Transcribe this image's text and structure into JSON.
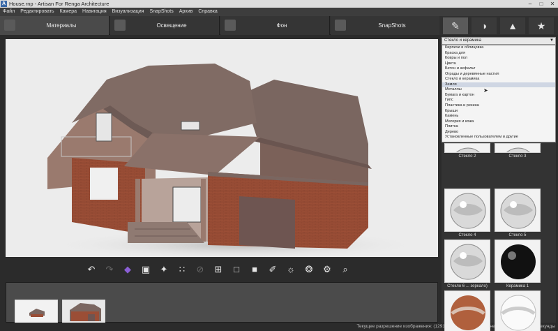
{
  "window": {
    "app_icon": "A",
    "title": "House.rnp - Artisan For Renga Architecture",
    "minimize": "–",
    "maximize": "□",
    "close": "✕"
  },
  "menu": [
    "Файл",
    "Редактировать",
    "Камера",
    "Навигация",
    "Визуализация",
    "SnapShots",
    "Архив",
    "Справка"
  ],
  "tabs": [
    {
      "label": "Материалы",
      "icon": "materials-icon",
      "active": true
    },
    {
      "label": "Освещение",
      "icon": "lighting-icon",
      "active": false
    },
    {
      "label": "Фон",
      "icon": "background-icon",
      "active": false
    },
    {
      "label": "SnapShots",
      "icon": "snapshots-icon",
      "active": false
    }
  ],
  "side_tabs": [
    {
      "icon": "brush-icon",
      "glyph": "✎",
      "active": true
    },
    {
      "icon": "sphere-icon",
      "glyph": "◑",
      "active": false
    },
    {
      "icon": "mountains-icon",
      "glyph": "▲",
      "active": false
    },
    {
      "icon": "star-icon",
      "glyph": "★",
      "active": false
    }
  ],
  "material_panel": {
    "selected_category": "Стекло и керамика",
    "categories": [
      "Кирпичи и облицовка",
      "Краска для",
      "Ковры и пол",
      "Цвета",
      "Бетон и асфальт",
      "Ограды и деревянные настил",
      "Стекло и керамика",
      "Земля",
      "Металлы",
      "Бумага и картон",
      "Гипс",
      "Пластика и резина",
      "Крыши",
      "Камень",
      "Материя и кожа",
      "Плитка",
      "Дерево",
      "Установленные пользователем и другие"
    ],
    "highlighted_index": 7,
    "swatches": [
      {
        "label": "Стекло 2",
        "kind": "glass"
      },
      {
        "label": "Стекло 3",
        "kind": "glass"
      },
      {
        "label": "Стекло 4",
        "kind": "glass"
      },
      {
        "label": "Стекло 5",
        "kind": "glass"
      },
      {
        "label": "Стекло 6 ... зеркало)",
        "kind": "glass"
      },
      {
        "label": "Керамика 1",
        "kind": "black"
      },
      {
        "label": "",
        "kind": "terracotta"
      },
      {
        "label": "",
        "kind": "white"
      }
    ]
  },
  "toolbar": [
    {
      "icon": "undo-icon",
      "glyph": "↶"
    },
    {
      "icon": "redo-icon",
      "glyph": "↷"
    },
    {
      "icon": "material-icon",
      "glyph": "◆"
    },
    {
      "icon": "replace-material-icon",
      "glyph": "▣"
    },
    {
      "icon": "arrange-icon",
      "glyph": "✦"
    },
    {
      "icon": "grid-icon",
      "glyph": "∷"
    },
    {
      "icon": "disabled-icon",
      "glyph": "⊘"
    },
    {
      "icon": "select-icon",
      "glyph": "⊞"
    },
    {
      "icon": "frame-icon",
      "glyph": "□"
    },
    {
      "icon": "camera-icon",
      "glyph": "■"
    },
    {
      "icon": "eyedropper-icon",
      "glyph": "✐"
    },
    {
      "icon": "sun-settings-icon",
      "glyph": "☼"
    },
    {
      "icon": "lamp-settings-icon",
      "glyph": "❂"
    },
    {
      "icon": "render-settings-icon",
      "glyph": "⚙"
    },
    {
      "icon": "image-search-icon",
      "glyph": "⌕"
    }
  ],
  "status": {
    "text": "Текущее разрешение изображения: (1291x658)  |  Время последней визуализации: 24 Секунды"
  },
  "colors": {
    "roof": "#7a6660",
    "wall": "#9a7a6e",
    "brick": "#9b4e36",
    "garage_door": "#6e5551"
  }
}
